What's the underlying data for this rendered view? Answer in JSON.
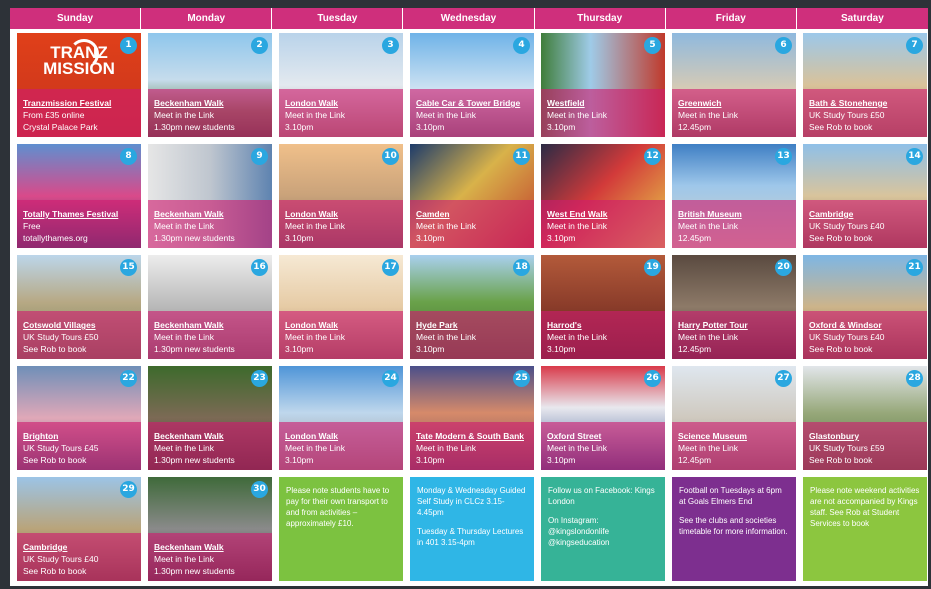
{
  "days_header": [
    "Sunday",
    "Monday",
    "Tuesday",
    "Wednesday",
    "Thursday",
    "Friday",
    "Saturday"
  ],
  "tranzmission_logo": "TRANZ MISSION",
  "cells": [
    {
      "num": "1",
      "title": "Tranzmission Festival",
      "lines": [
        "From £35 online",
        "Crystal Palace Park"
      ],
      "bg": "linear-gradient(180deg,#e0401a,#c7341c)"
    },
    {
      "num": "2",
      "title": "Beckenham Walk",
      "lines": [
        "Meet in the Link",
        "1.30pm    new students"
      ],
      "bg": "linear-gradient(180deg,#8ec6ec 0%,#c6dcec 45%,#6a8a5a 75%,#3d5534 100%)"
    },
    {
      "num": "3",
      "title": "London Walk",
      "lines": [
        "Meet in the Link",
        "3.10pm"
      ],
      "bg": "linear-gradient(180deg,#b9d3ea 0%,#e3e9ef 50%,#9a8c7c 100%)"
    },
    {
      "num": "4",
      "title": "Cable Car & Tower Bridge",
      "lines": [
        "Meet in the Link",
        "3.10pm"
      ],
      "bg": "linear-gradient(180deg,#6fb3e8 0%,#cfe3f2 55%,#6b7f8d 100%)"
    },
    {
      "num": "5",
      "title": "Westfield",
      "lines": [
        "Meet in the Link",
        "3.10pm"
      ],
      "bg": "linear-gradient(90deg,#3f7d3a 0%,#9fcbe8 40%,#c0392b 100%)"
    },
    {
      "num": "6",
      "title": "Greenwich",
      "lines": [
        "Meet in the Link",
        "12.45pm"
      ],
      "bg": "linear-gradient(180deg,#8fb9de 0%,#d8cbb4 55%,#7c6a55 100%)"
    },
    {
      "num": "7",
      "title": "Bath & Stonehenge",
      "lines": [
        "UK Study Tours £50",
        "See Rob to book"
      ],
      "bg": "linear-gradient(180deg,#9cc8ea 0%,#d9c29a 50%,#8f7a56 100%)"
    },
    {
      "num": "8",
      "title": "Totally Thames Festival",
      "lines": [
        "Free",
        "totallythames.org"
      ],
      "bg": "linear-gradient(180deg,#5f8fd0 0%,#d94a8a 50%,#2a3f70 100%)"
    },
    {
      "num": "9",
      "title": "Beckenham Walk",
      "lines": [
        "Meet in the Link",
        "1.30pm    new students"
      ],
      "bg": "linear-gradient(90deg,#e6e6e6 0%,#bfc6cf 50%,#5e83b0 100%)"
    },
    {
      "num": "10",
      "title": "London Walk",
      "lines": [
        "Meet in the Link",
        "3.10pm"
      ],
      "bg": "linear-gradient(180deg,#f0c08a 0%,#c9a27a 50%,#6f6558 100%)"
    },
    {
      "num": "11",
      "title": "Camden",
      "lines": [
        "Meet in the Link",
        "3.10pm"
      ],
      "bg": "linear-gradient(135deg,#1d3b6b 0%,#d8b24a 45%,#c0392b 100%)"
    },
    {
      "num": "12",
      "title": "West End Walk",
      "lines": [
        "Meet in the Link",
        "3.10pm"
      ],
      "bg": "linear-gradient(135deg,#2b2b45 0%,#d23a3a 45%,#e9d04a 100%)"
    },
    {
      "num": "13",
      "title": "British Museum",
      "lines": [
        "Meet in the Link",
        "12.45pm"
      ],
      "bg": "linear-gradient(180deg,#3f7fc4 0%,#9ec7ea 40%,#d7d2c6 100%)"
    },
    {
      "num": "14",
      "title": "Cambridge",
      "lines": [
        "UK Study Tours £40",
        "See Rob to book"
      ],
      "bg": "linear-gradient(180deg,#8fc0e8 0%,#d9c49c 50%,#7c6546 100%)"
    },
    {
      "num": "15",
      "title": "Cotswold Villages",
      "lines": [
        "UK Study Tours £50",
        "See Rob to book"
      ],
      "bg": "linear-gradient(180deg,#bcd6ea 0%,#b7a985 45%,#6c7b4e 100%)"
    },
    {
      "num": "16",
      "title": "Beckenham Walk",
      "lines": [
        "Meet in the Link",
        "1.30pm    new students"
      ],
      "bg": "linear-gradient(180deg,#ededed 0%,#b9b9b9 50%,#6f6f6f 100%)"
    },
    {
      "num": "17",
      "title": "London Walk",
      "lines": [
        "Meet in the Link",
        "3.10pm"
      ],
      "bg": "linear-gradient(180deg,#f6e9d4 0%,#e6cba5 50%,#8a7258 100%)"
    },
    {
      "num": "18",
      "title": "Hyde Park",
      "lines": [
        "Meet in the Link",
        "3.10pm"
      ],
      "bg": "linear-gradient(180deg,#a9d0ee 0%,#6aa24a 45%,#3c6a2c 100%)"
    },
    {
      "num": "19",
      "title": "Harrod's",
      "lines": [
        "Meet in the Link",
        "3.10pm"
      ],
      "bg": "linear-gradient(180deg,#b35a3a 0%,#8a3c2a 50%,#4a2418 100%)"
    },
    {
      "num": "20",
      "title": "Harry Potter Tour",
      "lines": [
        "Meet in the Link",
        "12.45pm"
      ],
      "bg": "linear-gradient(180deg,#5a4a40 0%,#8d7a68 50%,#3a2f2a 100%)"
    },
    {
      "num": "21",
      "title": "Oxford & Windsor",
      "lines": [
        "UK Study Tours £40",
        "See Rob to book"
      ],
      "bg": "linear-gradient(180deg,#7eb6e4 0%,#cdb48a 50%,#6f5a3c 100%)"
    },
    {
      "num": "22",
      "title": "Brighton",
      "lines": [
        "UK Study Tours £45",
        "See Rob to book"
      ],
      "bg": "linear-gradient(180deg,#6f8fb8 0%,#e0a8b8 50%,#4a5a7a 100%)"
    },
    {
      "num": "23",
      "title": "Beckenham Walk",
      "lines": [
        "Meet in the Link",
        "1.30pm    new students"
      ],
      "bg": "linear-gradient(180deg,#3d6a2c 0%,#7c6a55 50%,#2f3a26 100%)"
    },
    {
      "num": "24",
      "title": "London Walk",
      "lines": [
        "Meet in the Link",
        "3.10pm"
      ],
      "bg": "linear-gradient(180deg,#4f95d8 0%,#bfd7ec 45%,#8a8a8a 100%)"
    },
    {
      "num": "25",
      "title": "Tate Modern & South Bank",
      "lines": [
        "Meet in the Link",
        "3.10pm"
      ],
      "bg": "linear-gradient(180deg,#4b4f8a 0%,#d68a6a 45%,#6a4a5a 100%)"
    },
    {
      "num": "26",
      "title": "Oxford Street",
      "lines": [
        "Meet in the Link",
        "3.10pm"
      ],
      "bg": "linear-gradient(180deg,#d93a4a 0%,#e8e8ee 40%,#2f4f8f 100%)"
    },
    {
      "num": "27",
      "title": "Science Museum",
      "lines": [
        "Meet in the Link",
        "12.45pm"
      ],
      "bg": "linear-gradient(180deg,#dfe7ef 0%,#cfc9bf 50%,#7d7a73 100%)"
    },
    {
      "num": "28",
      "title": "Glastonbury",
      "lines": [
        "UK Study Tours £59",
        "See Rob to book"
      ],
      "bg": "linear-gradient(180deg,#e2e6ea 0%,#97a87a 45%,#4a6a34 100%)"
    },
    {
      "num": "29",
      "title": "Cambridge",
      "lines": [
        "UK Study Tours £40",
        "See Rob to book"
      ],
      "bg": "linear-gradient(180deg,#9cc4e6 0%,#b9a47a 50%,#6a5a3a 100%)"
    },
    {
      "num": "30",
      "title": "Beckenham Walk",
      "lines": [
        "Meet in the Link",
        "1.30pm    new students"
      ],
      "bg": "linear-gradient(180deg,#3f6a3a 0%,#8a8a8a 50%,#3a3a3a 100%)"
    }
  ],
  "notes": [
    {
      "paras": [
        "Please note students have to pay for their own transport to and from activities – approximately £10."
      ]
    },
    {
      "paras": [
        "Monday & Wednesday Guided Self Study in CLCz 3.15-4.45pm",
        "Tuesday & Thursday Lectures in 401 3.15-4pm"
      ]
    },
    {
      "paras": [
        "Follow us on Facebook: Kings London",
        "On Instagram: @kingslondonlife @kingseducation"
      ]
    },
    {
      "paras": [
        "Football on Tuesdays at 6pm at Goals Elmers End",
        "See the clubs and societies timetable for more information."
      ]
    },
    {
      "paras": [
        "Please note weekend activities are not accompanied by Kings staff. See Rob at Student Services to book"
      ]
    }
  ],
  "colors": {
    "header_bg": "#cf2f7c",
    "overlay": "#ce1c70",
    "badge": "#2aa7e0"
  }
}
